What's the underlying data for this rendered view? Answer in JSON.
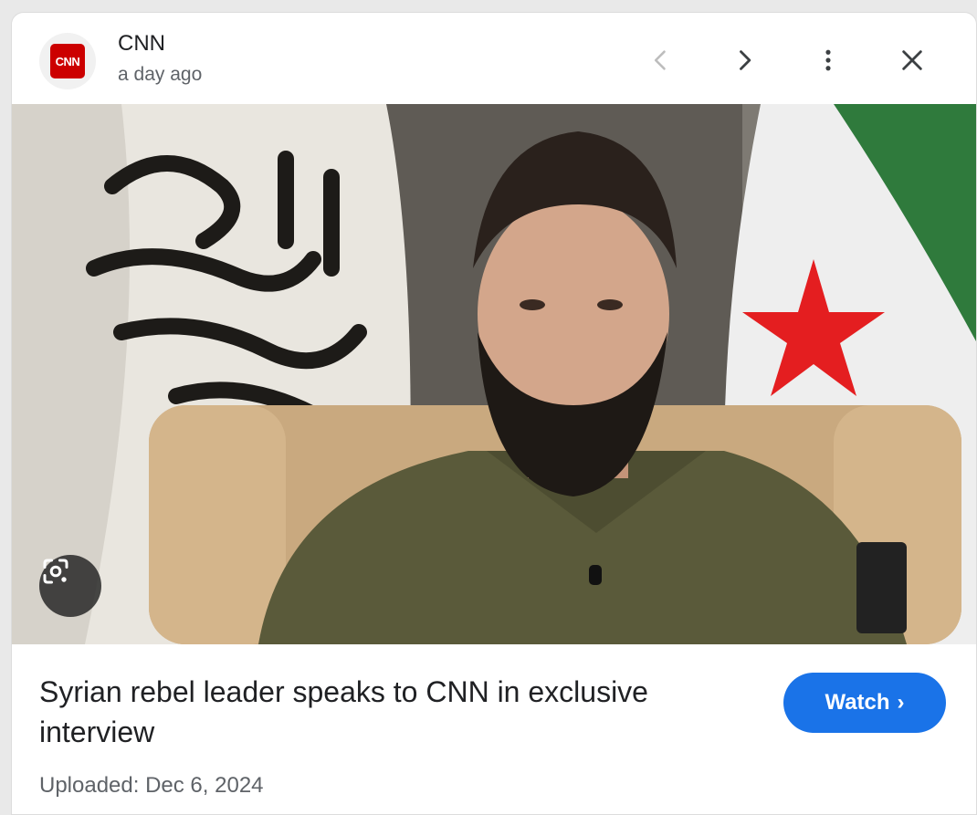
{
  "source": {
    "logo_text": "CNN",
    "name": "CNN",
    "time": "a day ago",
    "brand_color": "#cc0000"
  },
  "header_controls": {
    "prev_icon": "chevron-left-icon",
    "next_icon": "chevron-right-icon",
    "more_icon": "more-vertical-icon",
    "close_icon": "close-icon"
  },
  "image": {
    "overlay_icon": "lens-search-icon"
  },
  "article": {
    "headline": "Syrian rebel leader speaks to CNN in exclusive interview",
    "watch_label": "Watch",
    "watch_chevron": "›",
    "uploaded": "Uploaded: Dec 6, 2024"
  },
  "colors": {
    "accent": "#1a73e8",
    "text": "#202124",
    "muted": "#5f6368"
  }
}
